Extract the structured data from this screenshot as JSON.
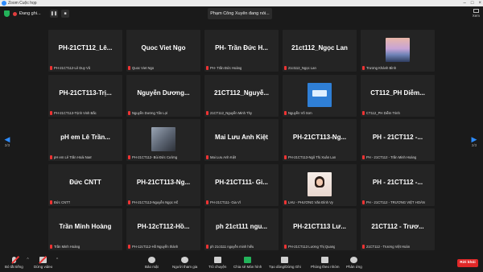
{
  "window": {
    "title": "Zoom Cuộc họp"
  },
  "header": {
    "recording_label": "Đang ghi...",
    "speaking_label": "Phạm Công Xuyên đang nói...",
    "view_label": "Xem",
    "pause_icon": "pause-icon",
    "stop_icon": "stop-icon"
  },
  "pager": {
    "left_page": "2/3",
    "right_page": "2/3"
  },
  "tiles": [
    {
      "name": "PH-21CT112_Lê...",
      "label": "PH-21CT112-Lê Duy Vũ"
    },
    {
      "name": "Quoc Viet Ngo",
      "label": "Quoc Viet Ngo"
    },
    {
      "name": "PH- Trần Đức H...",
      "label": "PH- Trần Đức Hoàng"
    },
    {
      "name": "21ct112_Ngọc Lan",
      "label": "21ct112_Ngọc Lan"
    },
    {
      "name": "",
      "label": "Trương Khánh Bình",
      "avatar": "sunset"
    },
    {
      "name": "PH-21CT113-Trị...",
      "label": "PH-21CT113-Trịnh Vinh Bắc"
    },
    {
      "name": "Nguyễn Dương...",
      "label": "Nguyễn Dương Tấn Lợi"
    },
    {
      "name": "21CT112_Nguyễ...",
      "label": "21CT112_Nguyễn Minh Thy"
    },
    {
      "name": "",
      "label": "Nguyễn Võ Sơn",
      "avatar": "blue"
    },
    {
      "name": "CT112_PH Diễm...",
      "label": "CT112_PH Diễm Trinh"
    },
    {
      "name": "pH em Lê Trần...",
      "label": "pH em Lê Trần Hoài Nam"
    },
    {
      "name": "",
      "label": "PH-21CT112- Bùi Đức Cường",
      "avatar": "street"
    },
    {
      "name": "Mai Lưu Anh Kiệt",
      "label": "Mai Lưu Anh Kiệt"
    },
    {
      "name": "PH-21CT113-Ng...",
      "label": "PH-21CT113-Ngô Thị Xuân Lan"
    },
    {
      "name": "PH - 21CT112 -...",
      "label": "PH - 21CT112 - Trần Minh Hoàng"
    },
    {
      "name": "Đức CNTT",
      "label": "Đức CNTT"
    },
    {
      "name": "PH-21CT113-Ng...",
      "label": "PH-21CT113-Nguyễn Ngọc Hồ"
    },
    {
      "name": "PH-21CT111- Gi...",
      "label": "PH-21CT111- Gia Vĩ"
    },
    {
      "name": "",
      "label": "LHU - PHƯƠNG Văn Đình Vy",
      "avatar": "person"
    },
    {
      "name": "PH - 21CT112 -...",
      "label": "PH - 21CT112 - TRƯƠNG VIỆT HOÀN"
    },
    {
      "name": "Trần Minh Hoàng",
      "label": "Trần Minh Hoàng"
    },
    {
      "name": "PH-12cT112-Hồ...",
      "label": "PH-12cT112-Hồ Nguyễn thành"
    },
    {
      "name": "ph 21ct111 ngu...",
      "label": "ph 21ct111 nguyễn minh hiếu"
    },
    {
      "name": "PH-21CT113 Lư...",
      "label": "PH-21CT113 Lương Thị Quang"
    },
    {
      "name": "21CT112 - Trươ...",
      "label": "21CT112 - Trương Việt Hoàn"
    }
  ],
  "toolbar": {
    "mute_label": "Bỏ tắt tiếng",
    "video_label": "Dừng video",
    "security_label": "Bảo mật",
    "participants_label": "Người tham gia",
    "participants_count": "70",
    "chat_label": "Trò chuyện",
    "share_label": "Chia sẻ Màn hình",
    "cc_label": "Tạo dòng/Dừng Ghi",
    "breakout_label": "Phòng theo nhóm",
    "reactions_label": "Phản ứng",
    "leave_label": "Rời khỏi"
  }
}
